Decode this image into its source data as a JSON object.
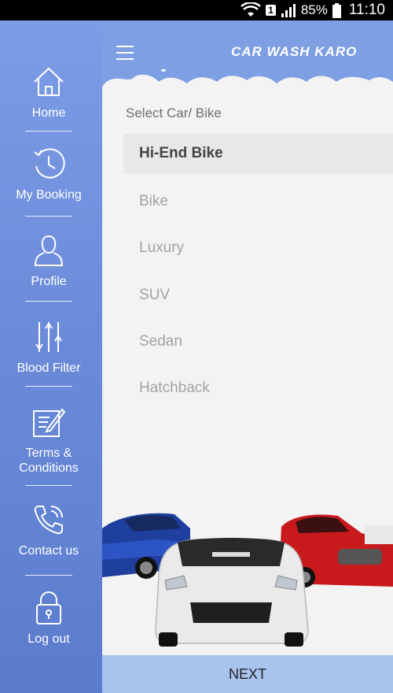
{
  "status_bar": {
    "battery": "85%",
    "time": "11:10",
    "sim_slot": "1"
  },
  "header": {
    "brand": "CAR WASH KARO"
  },
  "drawer": {
    "items": [
      {
        "label": "Home",
        "icon": "home-icon"
      },
      {
        "label": "My Booking",
        "icon": "history-icon"
      },
      {
        "label": "Profile",
        "icon": "user-icon"
      },
      {
        "label": "Blood Filter",
        "icon": "filter-sliders-icon"
      },
      {
        "label": "Terms &\nConditions",
        "icon": "document-edit-icon"
      },
      {
        "label": "Contact us",
        "icon": "phone-icon"
      },
      {
        "label": "Log out",
        "icon": "lock-icon"
      }
    ]
  },
  "main": {
    "select_title": "Select Car/ Bike",
    "options": [
      {
        "label": "Hi-End Bike",
        "selected": true
      },
      {
        "label": "Bike",
        "selected": false
      },
      {
        "label": "Luxury",
        "selected": false
      },
      {
        "label": "SUV",
        "selected": false
      },
      {
        "label": "Sedan",
        "selected": false
      },
      {
        "label": "Hatchback",
        "selected": false
      }
    ],
    "next_label": "NEXT"
  },
  "colors": {
    "drawer_top": "#7d9ce6",
    "drawer_bottom": "#5b7bcd",
    "header": "#7e9fe3",
    "next_button": "#a9c3ef"
  }
}
